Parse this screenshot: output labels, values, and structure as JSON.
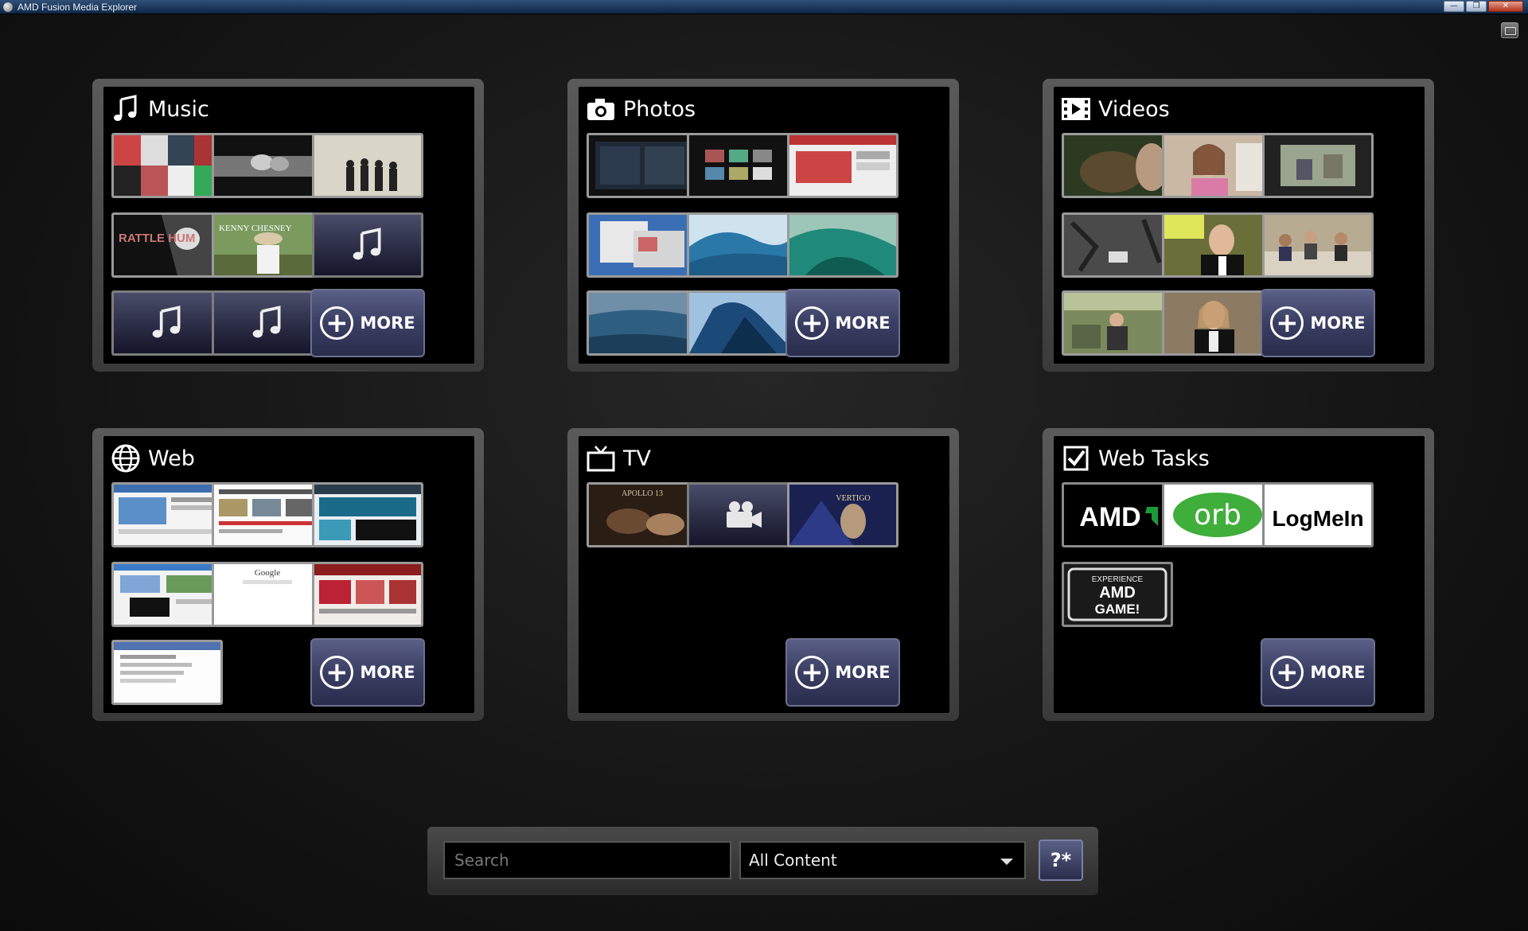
{
  "window": {
    "title": "AMD Fusion Media Explorer"
  },
  "panels": {
    "music": {
      "title": "Music",
      "more_label": "MORE"
    },
    "photos": {
      "title": "Photos",
      "more_label": "MORE"
    },
    "videos": {
      "title": "Videos",
      "more_label": "MORE"
    },
    "web": {
      "title": "Web",
      "more_label": "MORE"
    },
    "tv": {
      "title": "TV",
      "more_label": "MORE"
    },
    "webtasks": {
      "title": "Web Tasks",
      "more_label": "MORE",
      "logos": {
        "amd": "AMD",
        "orb": "orb",
        "logmein": "LogMeIn",
        "game_line1": "EXPERIENCE",
        "game_line2": "AMD",
        "game_line3": "GAME!"
      }
    }
  },
  "tv": {
    "tile1_caption": "APOLLO 13",
    "tile3_caption": "VERTIGO"
  },
  "web": {
    "google_text": "Google"
  },
  "music": {
    "tile4_caption": "RATTLE HUM",
    "tile5_caption": "KENNY CHESNEY"
  },
  "search": {
    "placeholder": "Search",
    "scope_value": "All Content",
    "go_label": "?*"
  },
  "icons": {
    "music": "music-note-icon",
    "photos": "camera-icon",
    "videos": "film-icon",
    "web": "globe-icon",
    "tv": "tv-icon",
    "webtasks": "checkbox-icon"
  }
}
